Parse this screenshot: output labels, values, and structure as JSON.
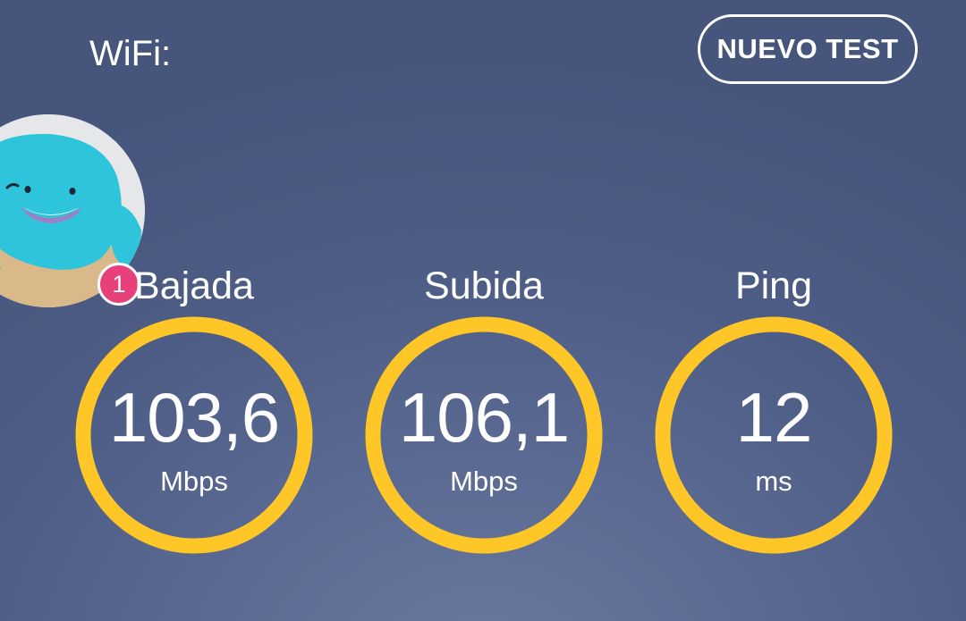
{
  "header": {
    "network_label": "WiFi:",
    "new_test_label": "NUEVO TEST"
  },
  "avatar": {
    "notification_count": "1"
  },
  "metrics": [
    {
      "label": "Bajada",
      "value": "103,6",
      "unit": "Mbps"
    },
    {
      "label": "Subida",
      "value": "106,1",
      "unit": "Mbps"
    },
    {
      "label": "Ping",
      "value": "12",
      "unit": "ms"
    }
  ],
  "colors": {
    "ring": "#ffc627",
    "badge": "#e8407a",
    "text": "#ffffff"
  }
}
